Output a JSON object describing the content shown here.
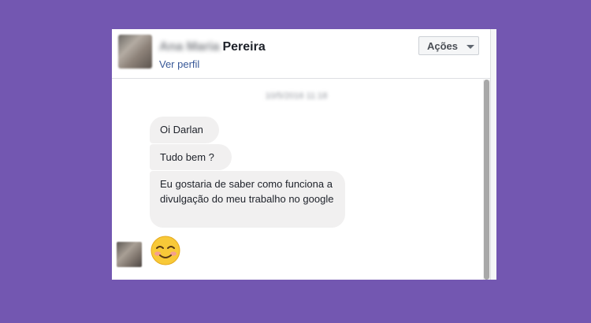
{
  "header": {
    "first_name_blurred": "Ana Maria",
    "last_name": "Pereira",
    "profile_link": "Ver perfil",
    "actions_label": "Ações"
  },
  "conversation": {
    "timestamp": "10/5/2016 11:18",
    "messages": [
      {
        "text": "Oi Darlan"
      },
      {
        "text": "Tudo bem ?"
      },
      {
        "text": "Eu gostaria de saber como funciona a divulgação do meu trabalho no google"
      }
    ],
    "reply_emoji": "smiling-face-with-smiling-eyes"
  },
  "colors": {
    "background": "#7357b1",
    "bubble": "#f1f0f0",
    "link": "#385898",
    "emoji_face": "#f8c938",
    "emoji_blush": "#f39a9a"
  }
}
